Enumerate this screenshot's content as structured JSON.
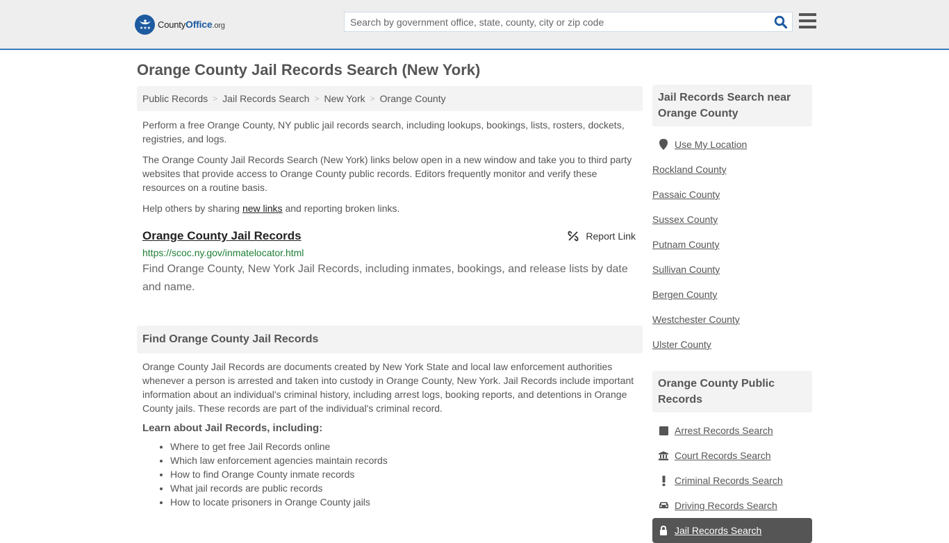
{
  "header": {
    "logo": {
      "county": "County",
      "office": "Office",
      "org": ".org"
    },
    "search": {
      "placeholder": "Search by government office, state, county, city or zip code",
      "value": ""
    }
  },
  "page": {
    "title": "Orange County Jail Records Search (New York)"
  },
  "breadcrumb": [
    {
      "label": "Public Records"
    },
    {
      "label": "Jail Records Search"
    },
    {
      "label": "New York"
    },
    {
      "label": "Orange County"
    }
  ],
  "intro": {
    "p1": "Perform a free Orange County, NY public jail records search, including lookups, bookings, lists, rosters, dockets, registries, and logs.",
    "p2": "The Orange County Jail Records Search (New York) links below open in a new window and take you to third party websites that provide access to Orange County public records. Editors frequently monitor and verify these resources on a routine basis.",
    "p3_before": "Help others by sharing ",
    "p3_link": "new links",
    "p3_after": " and reporting broken links."
  },
  "result": {
    "title": "Orange County Jail Records",
    "report_label": "Report Link",
    "url": "https://scoc.ny.gov/inmatelocator.html",
    "description": "Find Orange County, New York Jail Records, including inmates, bookings, and release lists by date and name."
  },
  "find_section": {
    "heading": "Find Orange County Jail Records",
    "body": "Orange County Jail Records are documents created by New York State and local law enforcement authorities whenever a person is arrested and taken into custody in Orange County, New York. Jail Records include important information about an individual's criminal history, including arrest logs, booking reports, and detentions in Orange County jails. These records are part of the individual's criminal record.",
    "learn_title": "Learn about Jail Records, including:",
    "learn_items": [
      "Where to get free Jail Records online",
      "Which law enforcement agencies maintain records",
      "How to find Orange County inmate records",
      "What jail records are public records",
      "How to locate prisoners in Orange County jails"
    ]
  },
  "sidebar": {
    "near_heading": "Jail Records Search near Orange County",
    "use_location": "Use My Location",
    "near_items": [
      "Rockland County",
      "Passaic County",
      "Sussex County",
      "Putnam County",
      "Sullivan County",
      "Bergen County",
      "Westchester County",
      "Ulster County"
    ],
    "public_heading": "Orange County Public Records",
    "public_items": [
      {
        "label": "Arrest Records Search",
        "icon": "square-icon"
      },
      {
        "label": "Court Records Search",
        "icon": "courthouse-icon"
      },
      {
        "label": "Criminal Records Search",
        "icon": "exclamation-icon"
      },
      {
        "label": "Driving Records Search",
        "icon": "car-icon"
      },
      {
        "label": "Jail Records Search",
        "icon": "lock-icon",
        "active": true
      }
    ]
  }
}
